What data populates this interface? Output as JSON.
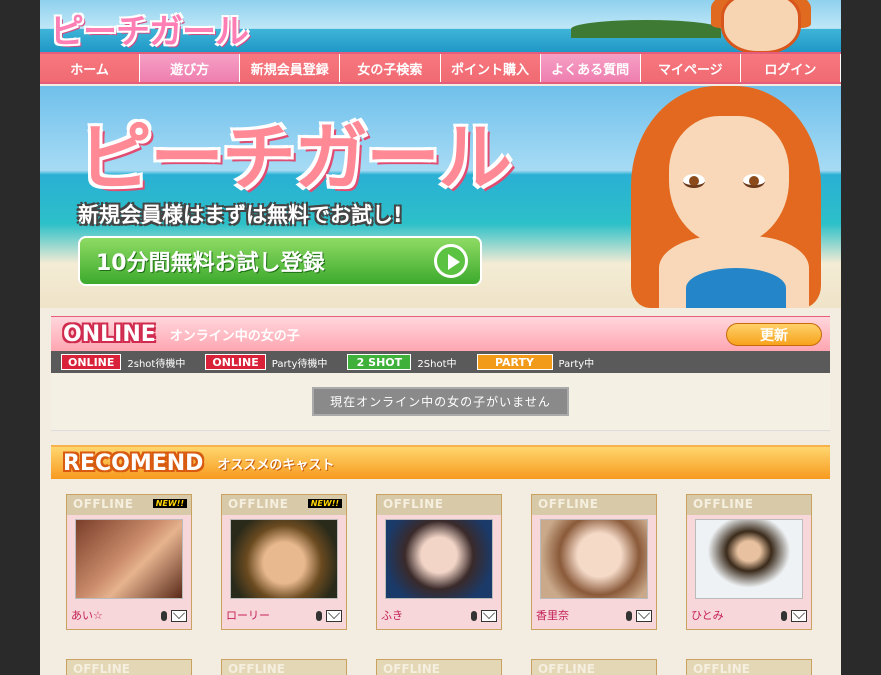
{
  "header": {
    "logo": "ピーチガール"
  },
  "nav": {
    "items": [
      "ホーム",
      "遊び方",
      "新規会員登録",
      "女の子検索",
      "ポイント購入",
      "よくある質問",
      "マイページ",
      "ログイン"
    ]
  },
  "hero": {
    "title": "ピーチガール",
    "subtitle": "新規会員様はまずは無料でお試し!",
    "cta": "10分間無料お試し登録"
  },
  "online": {
    "title": "ONLINE",
    "subtitle": "オンライン中の女の子",
    "refresh": "更新",
    "legend": [
      {
        "badge": "ONLINE",
        "text": "2shot待機中"
      },
      {
        "badge": "ONLINE",
        "text": "Party待機中"
      },
      {
        "badge": "2 SHOT",
        "text": "2Shot中"
      },
      {
        "badge": "PARTY",
        "text": "Party中"
      }
    ],
    "empty_message": "現在オンライン中の女の子がいません"
  },
  "recommend": {
    "title": "RECOMEND",
    "subtitle": "オススメのキャスト",
    "cards": [
      {
        "status": "OFFLINE",
        "new": "NEW!!",
        "name": "あい☆"
      },
      {
        "status": "OFFLINE",
        "new": "NEW!!",
        "name": "ローリー"
      },
      {
        "status": "OFFLINE",
        "new": "",
        "name": "ふき"
      },
      {
        "status": "OFFLINE",
        "new": "",
        "name": "香里奈"
      },
      {
        "status": "OFFLINE",
        "new": "",
        "name": "ひとみ"
      }
    ],
    "cards_row2": [
      "OFFLINE",
      "OFFLINE",
      "OFFLINE",
      "OFFLINE",
      "OFFLINE"
    ]
  },
  "colors": {
    "accent_pink": "#f06a72",
    "accent_orange": "#f79a1e",
    "online_red": "#d9213a",
    "twoshot_green": "#3fb13a"
  }
}
